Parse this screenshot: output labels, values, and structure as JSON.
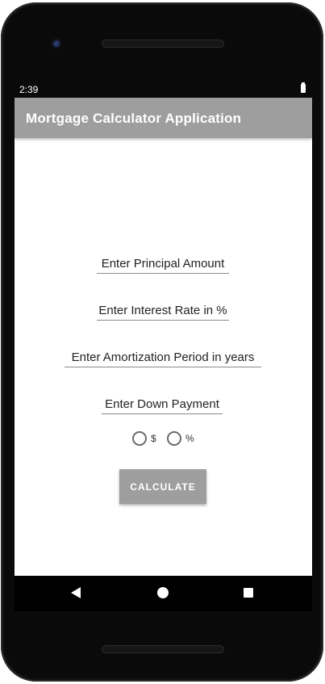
{
  "status": {
    "time": "2:39"
  },
  "app": {
    "title": "Mortgage Calculator Application",
    "fields": {
      "principal_placeholder": "Enter Principal Amount",
      "interest_placeholder": "Enter Interest Rate in %",
      "amortization_placeholder": "Enter Amortization Period in years",
      "down_payment_placeholder": "Enter Down Payment"
    },
    "down_payment_type": {
      "options": [
        "$",
        "%"
      ]
    },
    "calculate_label": "CALCULATE"
  },
  "colors": {
    "app_bar": "#9e9e9e",
    "button": "#9e9e9e",
    "text": "#222222"
  },
  "icons": [
    "battery-icon",
    "back-icon",
    "home-icon",
    "recents-icon"
  ]
}
